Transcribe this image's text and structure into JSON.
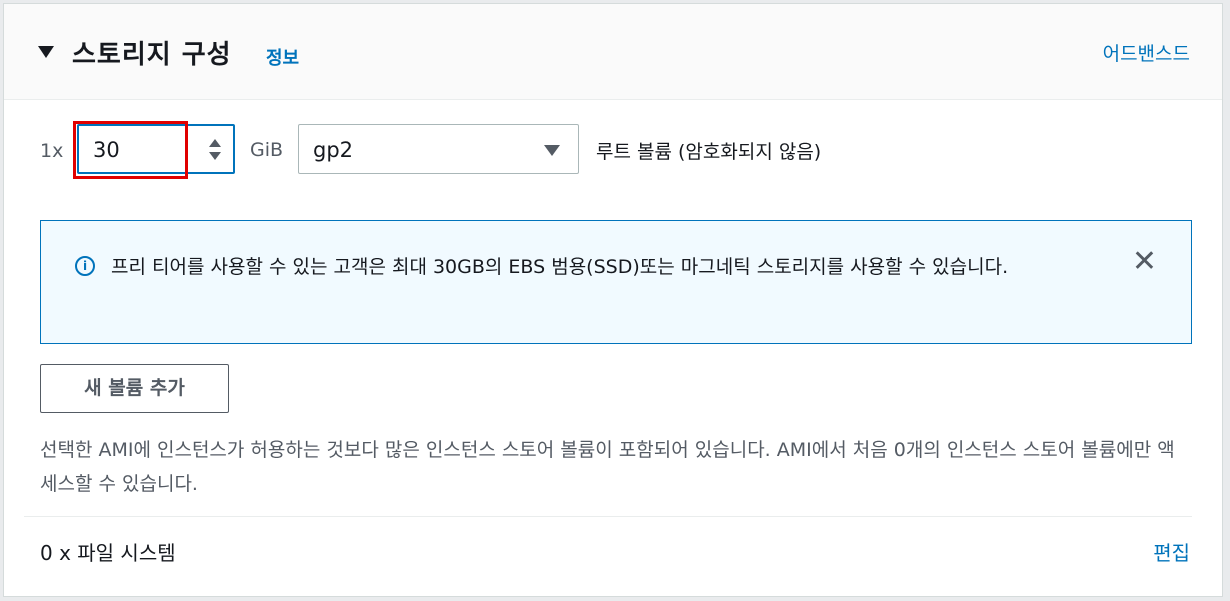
{
  "header": {
    "title": "스토리지 구성",
    "info_link": "정보",
    "advanced_link": "어드밴스드"
  },
  "volume": {
    "multiplier": "1x",
    "size": "30",
    "unit": "GiB",
    "type": "gp2",
    "label": "루트 볼륨  (암호화되지 않음)"
  },
  "alert": {
    "text": "프리 티어를 사용할 수 있는 고객은 최대 30GB의 EBS 범용(SSD)또는 마그네틱 스토리지를 사용할 수 있습니다."
  },
  "add_volume_button": "새 볼륨 추가",
  "note": "선택한 AMI에 인스턴스가 허용하는 것보다 많은 인스턴스 스토어 볼륨이 포함되어 있습니다. AMI에서 처음 0개의 인스턴스 스토어 볼륨에만 액세스할 수 있습니다.",
  "file_systems": {
    "label": "0 x 파일 시스템",
    "edit_link": "편집"
  }
}
